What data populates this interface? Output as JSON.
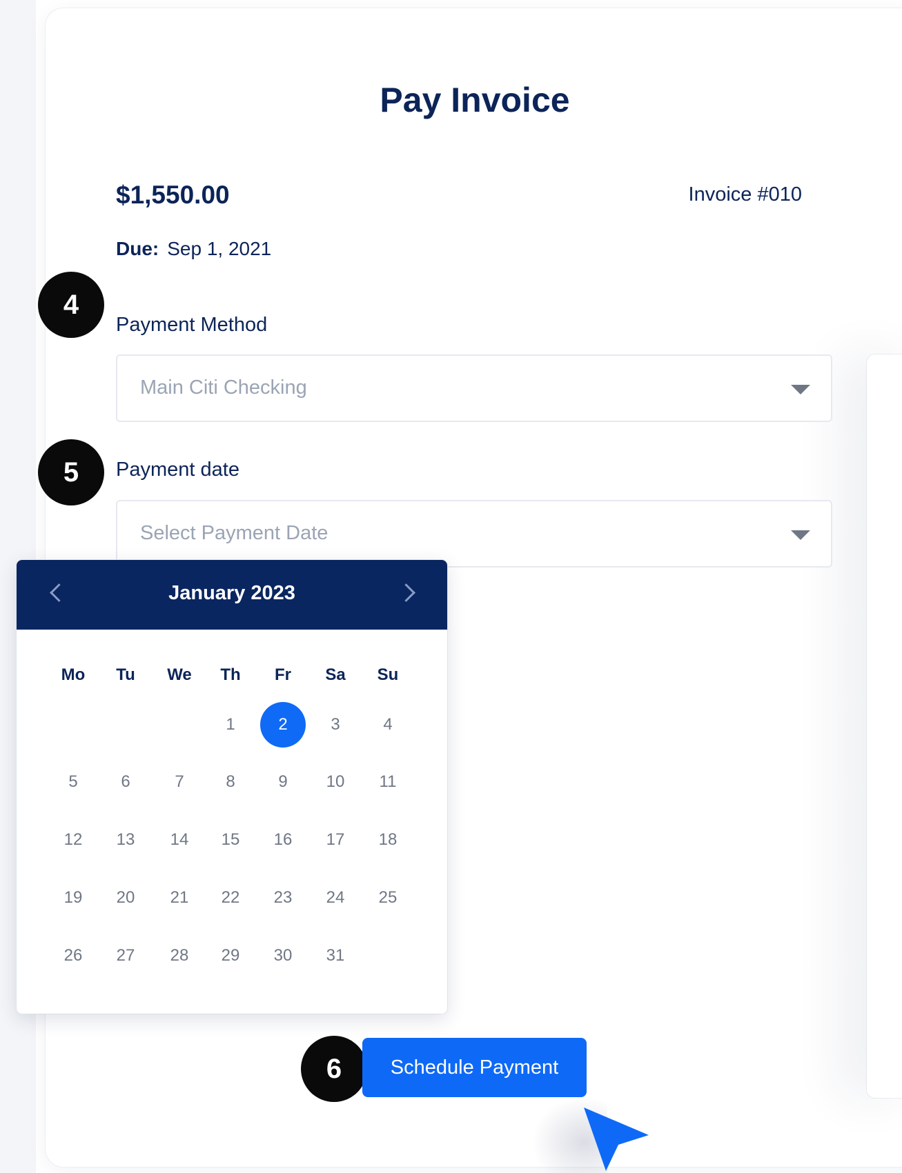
{
  "page": {
    "title": "Pay Invoice",
    "amount": "$1,550.00",
    "invoice_number": "Invoice #010",
    "due_label": "Due:",
    "due_date": "Sep 1, 2021"
  },
  "payment_method": {
    "step": "4",
    "label": "Payment Method",
    "value": "Main Citi Checking"
  },
  "payment_date": {
    "step": "5",
    "label": "Payment date",
    "placeholder": "Select Payment Date"
  },
  "calendar": {
    "month_label": "January 2023",
    "weekdays": [
      "Mo",
      "Tu",
      "We",
      "Th",
      "Fr",
      "Sa",
      "Su"
    ],
    "first_weekday_index": 3,
    "days_in_month": 31,
    "selected_day": 2,
    "days": [
      "1",
      "2",
      "3",
      "4",
      "5",
      "6",
      "7",
      "8",
      "9",
      "10",
      "11",
      "12",
      "13",
      "14",
      "15",
      "16",
      "17",
      "18",
      "19",
      "20",
      "21",
      "22",
      "23",
      "24",
      "25",
      "26",
      "27",
      "28",
      "29",
      "30",
      "31"
    ],
    "selected_color": "#0f6af6",
    "header_color": "#0a2660"
  },
  "schedule": {
    "step": "6",
    "button_label": "Schedule Payment",
    "button_color": "#0e6af6"
  },
  "icons": {
    "prev": "chevron-left-icon",
    "next": "chevron-right-icon",
    "dropdown": "caret-down-icon",
    "cursor": "cursor-pointer-icon"
  }
}
